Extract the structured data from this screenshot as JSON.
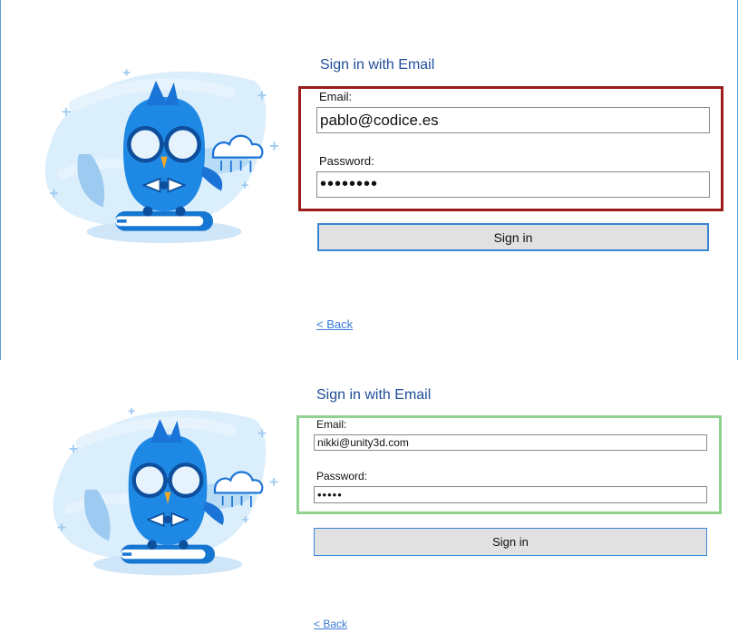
{
  "top": {
    "title": "Sign in with Email",
    "email_label": "Email:",
    "email_value": "pablo@codice.es",
    "password_label": "Password:",
    "password_value": "••••••••",
    "signin_label": "Sign in",
    "back_label": "< Back",
    "highlight_color": "#9b1c1c"
  },
  "bottom": {
    "title": "Sign in with Email",
    "email_label": "Email:",
    "email_value": "nikki@unity3d.com",
    "password_label": "Password:",
    "password_value": "•••••",
    "signin_label": "Sign in",
    "back_label": "< Back",
    "highlight_color": "#8fd18f"
  },
  "illustration": "owl-on-books-with-cloud"
}
